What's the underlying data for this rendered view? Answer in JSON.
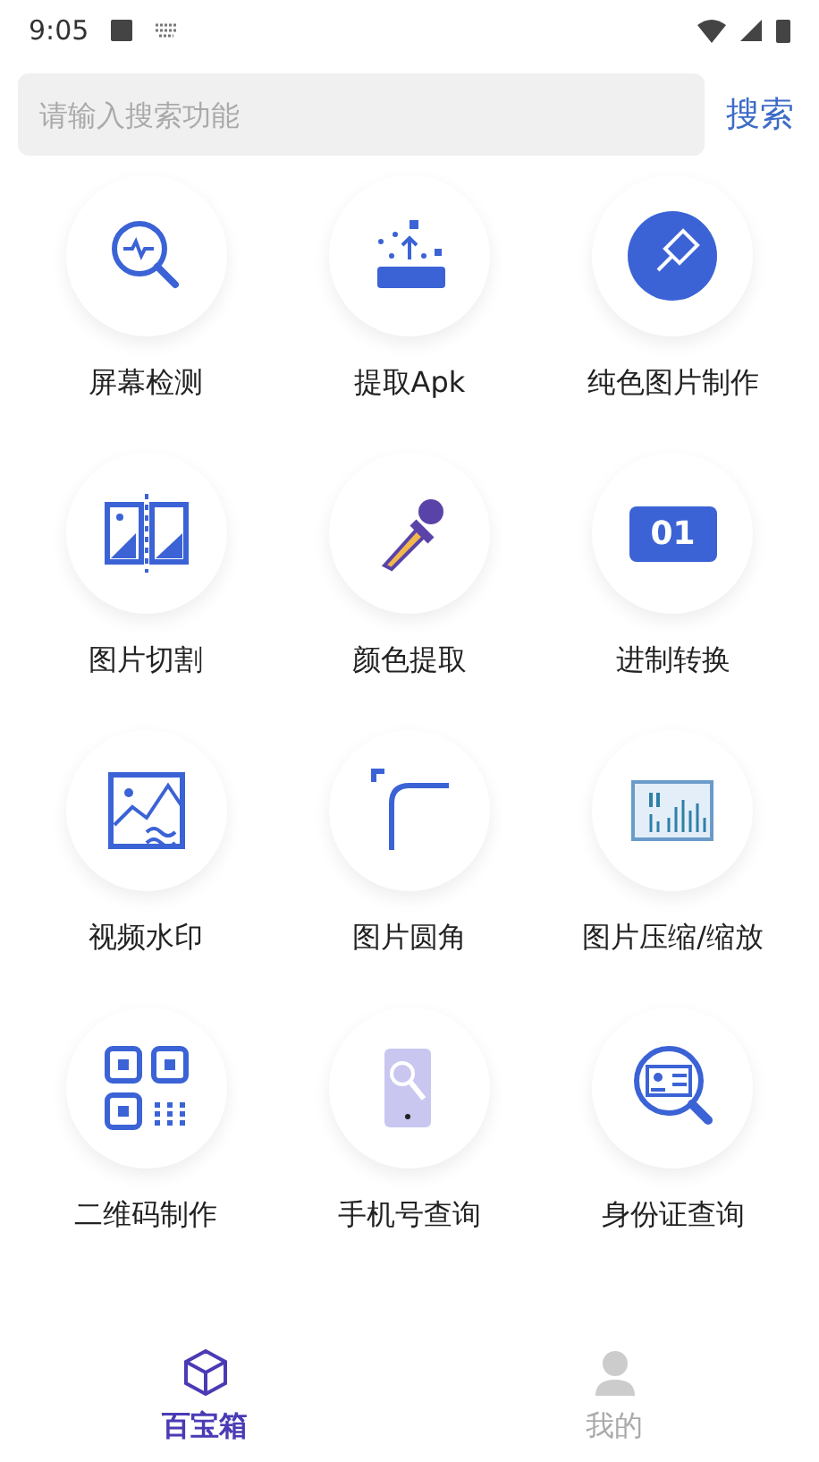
{
  "status_bar": {
    "time": "9:05"
  },
  "search": {
    "placeholder": "请输入搜索功能",
    "button": "搜索"
  },
  "tools": [
    {
      "label": "屏幕检测"
    },
    {
      "label": "提取Apk"
    },
    {
      "label": "纯色图片制作"
    },
    {
      "label": "图片切割"
    },
    {
      "label": "颜色提取"
    },
    {
      "label": "进制转换"
    },
    {
      "label": "视频水印"
    },
    {
      "label": "图片圆角"
    },
    {
      "label": "图片压缩/缩放"
    },
    {
      "label": "二维码制作"
    },
    {
      "label": "手机号查询"
    },
    {
      "label": "身份证查询"
    }
  ],
  "binary_tool_icon_text": "01",
  "bottom_nav": [
    {
      "label": "百宝箱",
      "selected": true
    },
    {
      "label": "我的",
      "selected": false
    }
  ]
}
